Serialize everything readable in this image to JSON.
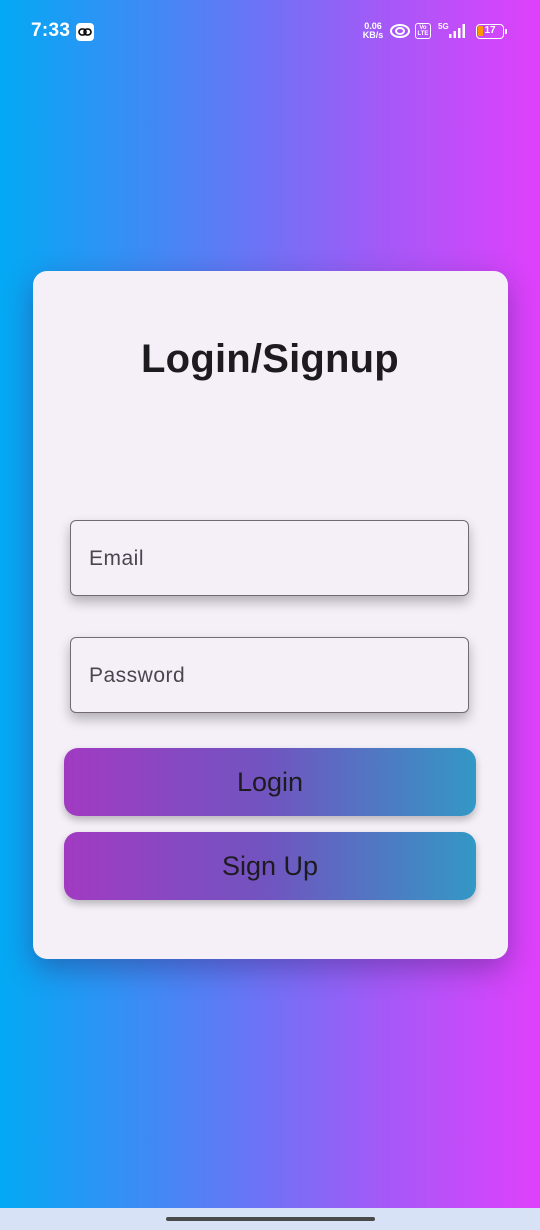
{
  "status_bar": {
    "time": "7:33",
    "net_speed": "0.06",
    "net_speed_unit": "KB/s",
    "volte_label": "Vo LTE",
    "network_type": "5G",
    "battery_level": "17",
    "icons": [
      "link-icon",
      "hotspot-icon",
      "volte-icon",
      "signal-icon",
      "battery-icon"
    ]
  },
  "login_card": {
    "title": "Login/Signup",
    "email": {
      "placeholder": "Email",
      "value": ""
    },
    "password": {
      "placeholder": "Password",
      "value": ""
    },
    "login_label": "Login",
    "signup_label": "Sign Up"
  },
  "colors": {
    "background_start": "#03a9f4",
    "background_end": "#e040fb",
    "card_background": "#f5f0f8",
    "button_start": "#a13ac2",
    "button_end": "#3398c5",
    "title_text": "#1d1b20"
  }
}
